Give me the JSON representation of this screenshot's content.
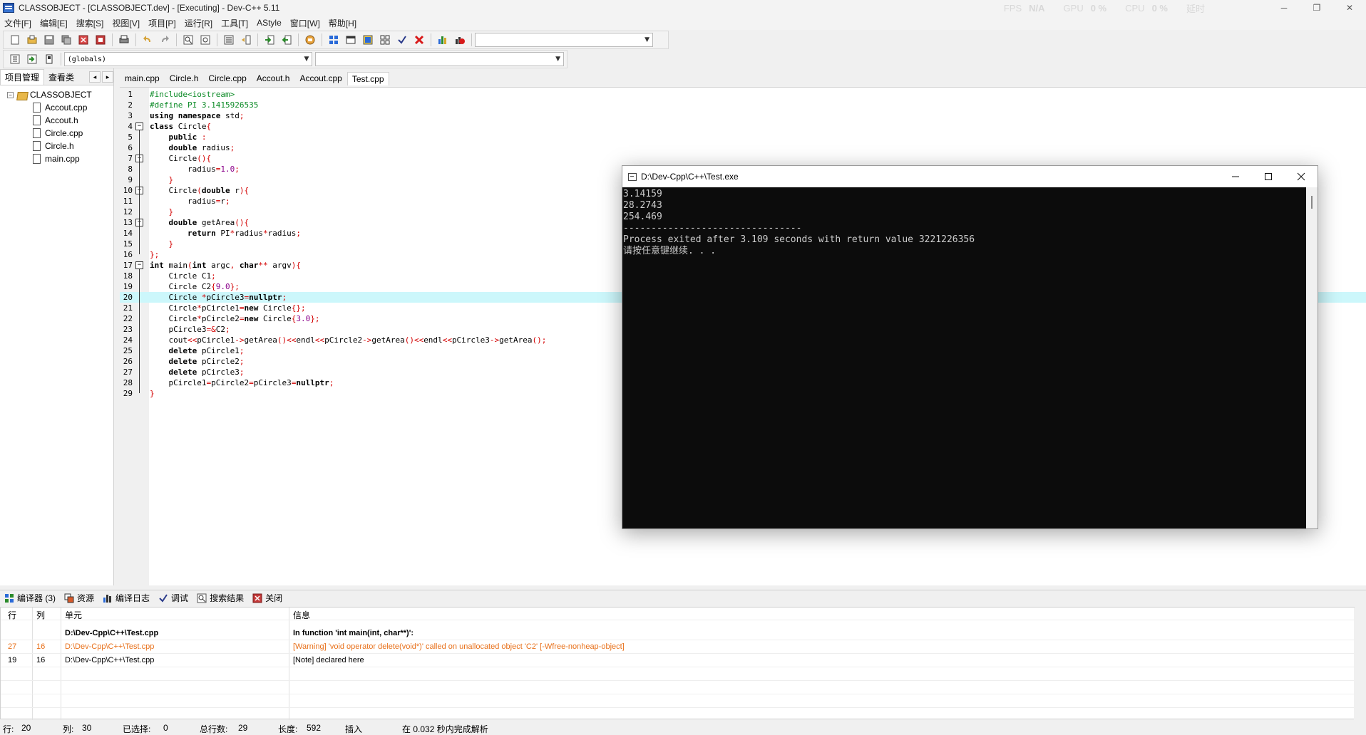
{
  "window": {
    "title": "CLASSOBJECT - [CLASSOBJECT.dev] - [Executing] - Dev-C++ 5.11",
    "perf": [
      {
        "label": "FPS",
        "value": "N/A"
      },
      {
        "label": "GPU",
        "value": "0 %"
      },
      {
        "label": "CPU",
        "value": "0 %"
      },
      {
        "label": "延时",
        "value": ""
      }
    ],
    "min": "─",
    "max": "❐",
    "close": "✕"
  },
  "menu": [
    "文件[F]",
    "编辑[E]",
    "搜索[S]",
    "视图[V]",
    "项目[P]",
    "运行[R]",
    "工具[T]",
    "AStyle",
    "窗口[W]",
    "帮助[H]"
  ],
  "toolbar": {
    "compiler_combo": "",
    "scope_combo": "(globals)",
    "function_combo": ""
  },
  "left_panel": {
    "tabs": [
      "项目管理",
      "查看类"
    ],
    "arrow_left": "◂",
    "arrow_right": "▸",
    "project": "CLASSOBJECT",
    "files": [
      "Accout.cpp",
      "Accout.h",
      "Circle.cpp",
      "Circle.h",
      "main.cpp"
    ]
  },
  "editor": {
    "tabs": [
      "main.cpp",
      "Circle.h",
      "Circle.cpp",
      "Accout.h",
      "Accout.cpp",
      "Test.cpp"
    ],
    "active_tab": 5,
    "highlighted_line": 20,
    "lines": [
      "#include<iostream>",
      "#define PI 3.1415926535",
      "using namespace std;",
      "class Circle{",
      "    public :",
      "    double radius;",
      "    Circle(){",
      "        radius=1.0;",
      "    }",
      "    Circle(double r){",
      "        radius=r;",
      "    }",
      "    double getArea(){",
      "        return PI*radius*radius;",
      "    }",
      "};",
      "int main(int argc, char** argv){",
      "    Circle C1;",
      "    Circle C2{9.0};",
      "    Circle *pCircle3=nullptr;",
      "    Circle*pCircle1=new Circle{};",
      "    Circle*pCircle2=new Circle{3.0};",
      "    pCircle3=&C2;",
      "    cout<<pCircle1->getArea()<<endl<<pCircle2->getArea()<<endl<<pCircle3->getArea();",
      "    delete pCircle1;",
      "    delete pCircle2;",
      "    delete pCircle3;",
      "    pCircle1=pCircle2=pCircle3=nullptr;",
      "}"
    ]
  },
  "console": {
    "title": "D:\\Dev-Cpp\\C++\\Test.exe",
    "output": "3.14159\n28.2743\n254.469\n--------------------------------\nProcess exited after 3.109 seconds with return value 3221226356\n请按任意键继续. . ."
  },
  "bottom_panel": {
    "tabs": [
      {
        "label": "编译器 (3)",
        "icon": "grid-icon"
      },
      {
        "label": "资源",
        "icon": "resources-icon"
      },
      {
        "label": "编译日志",
        "icon": "chart-icon"
      },
      {
        "label": "调试",
        "icon": "check-icon"
      },
      {
        "label": "搜索结果",
        "icon": "search-icon"
      },
      {
        "label": "关闭",
        "icon": "close-icon"
      }
    ],
    "columns": [
      "行",
      "列",
      "单元",
      "信息"
    ],
    "rows": [
      {
        "line": "",
        "col": "",
        "unit": "D:\\Dev-Cpp\\C++\\Test.cpp",
        "message": "In function 'int main(int, char**)':",
        "kind": "header"
      },
      {
        "line": "27",
        "col": "16",
        "unit": "D:\\Dev-Cpp\\C++\\Test.cpp",
        "message": "[Warning] 'void operator delete(void*)' called on unallocated object 'C2' [-Wfree-nonheap-object]",
        "kind": "warning"
      },
      {
        "line": "19",
        "col": "16",
        "unit": "D:\\Dev-Cpp\\C++\\Test.cpp",
        "message": "[Note] declared here",
        "kind": "note"
      }
    ]
  },
  "statusbar": {
    "row_label": "行:",
    "row_value": "20",
    "col_label": "列:",
    "col_value": "30",
    "sel_label": "已选择:",
    "sel_value": "0",
    "lines_label": "总行数:",
    "lines_value": "29",
    "len_label": "长度:",
    "len_value": "592",
    "mode": "插入",
    "parse": "在 0.032 秒内完成解析"
  },
  "colors": {
    "keyword": "#000000",
    "preprocessor": "#0a8a25",
    "symbol": "#d30000",
    "number": "#8a008a",
    "highlight": "#ccf7fb",
    "warning": "#e8701a"
  }
}
